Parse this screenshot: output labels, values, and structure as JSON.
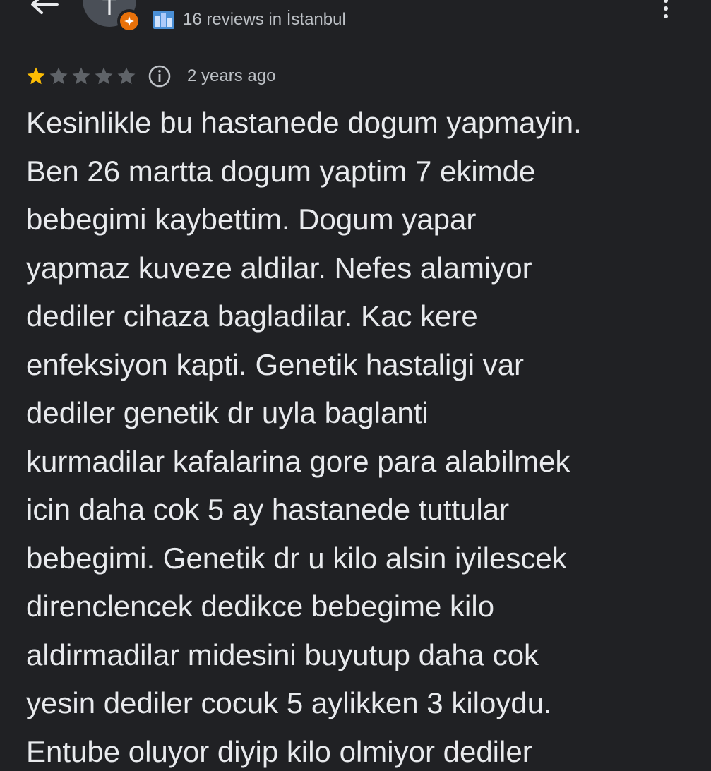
{
  "header": {
    "avatar_letter": "T",
    "reviewer_meta": "16 reviews in İstanbul",
    "icons": {
      "back": "arrow-back-icon",
      "guide_badge": "local-guide-badge-icon",
      "city": "city-icon",
      "more": "more-vert-icon"
    },
    "colors": {
      "badge": "#e8710a",
      "background": "#202124"
    }
  },
  "review": {
    "rating": 1,
    "max_rating": 5,
    "time_ago": "2 years ago",
    "text": "Kesinlikle bu hastanede dogum yapmayin.\nBen 26 martta dogum yaptim 7 ekimde\nbebegimi kaybettim. Dogum yapar\nyapmaz kuveze aldilar. Nefes alamiyor\ndediler cihaza bagladilar. Kac kere\nenfeksiyon kapti. Genetik hastaligi var\ndediler genetik dr uyla baglanti\nkurmadilar kafalarina gore para alabilmek\nicin daha cok 5 ay hastanede tuttular\nbebegimi. Genetik dr u kilo alsin iyilescek\ndirenclencek dedikce bebegime kilo\naldirmadilar midesini buyutup daha cok\nyesin dediler cocuk 5 aylikken 3 kiloydu.\nEntube oluyor diyip kilo olmiyor dediler",
    "icons": {
      "star_filled": "star-filled-icon",
      "star_empty": "star-empty-icon",
      "info": "info-icon"
    },
    "colors": {
      "star_filled": "#fbbc04",
      "star_empty": "#5f6368"
    }
  }
}
